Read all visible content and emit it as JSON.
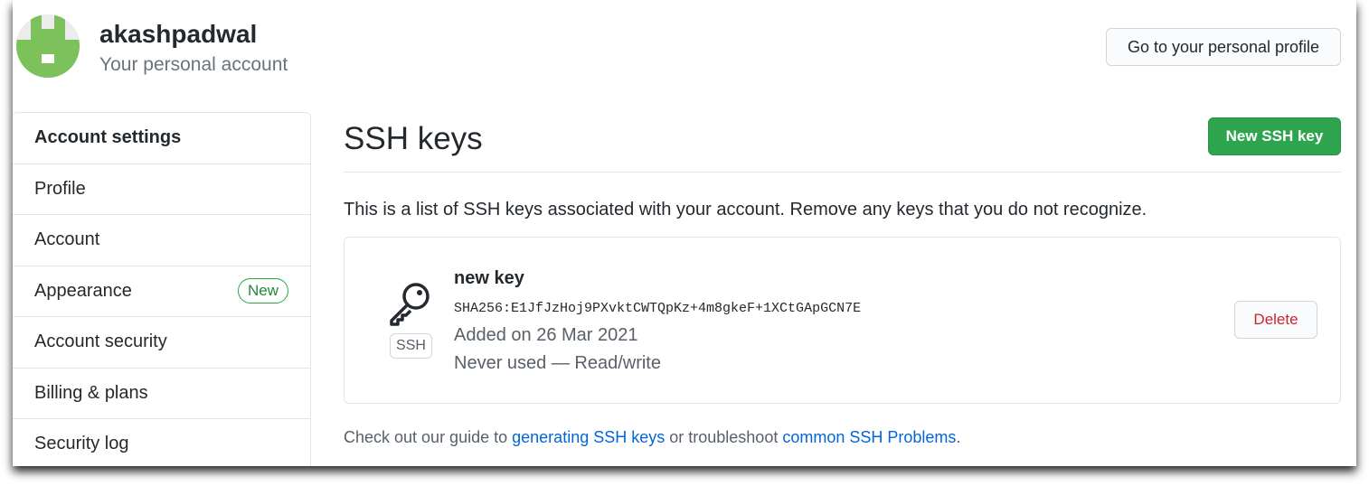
{
  "header": {
    "username": "akashpadwal",
    "subtitle": "Your personal account",
    "profile_button": "Go to your personal profile"
  },
  "sidebar": {
    "title": "Account settings",
    "items": [
      {
        "label": "Profile"
      },
      {
        "label": "Account"
      },
      {
        "label": "Appearance",
        "badge": "New"
      },
      {
        "label": "Account security"
      },
      {
        "label": "Billing & plans"
      },
      {
        "label": "Security log"
      }
    ]
  },
  "main": {
    "title": "SSH keys",
    "new_button": "New SSH key",
    "description": "This is a list of SSH keys associated with your account. Remove any keys that you do not recognize.",
    "key": {
      "tag": "SSH",
      "name": "new key",
      "fingerprint": "SHA256:E1JfJzHoj9PXvktCWTQpKz+4m8gkeF+1XCtGApGCN7E",
      "added": "Added on 26 Mar 2021",
      "usage": "Never used — Read/write",
      "delete_button": "Delete",
      "icon": "key-icon"
    },
    "footer": {
      "prefix": "Check out our guide to",
      "link1": "generating SSH keys",
      "middle": "or troubleshoot",
      "link2": "common SSH Problems",
      "suffix": "."
    }
  },
  "colors": {
    "primary_green": "#2ea44f",
    "danger_red": "#cb2431",
    "link_blue": "#0366d6",
    "avatar_green": "#7dc15a"
  }
}
